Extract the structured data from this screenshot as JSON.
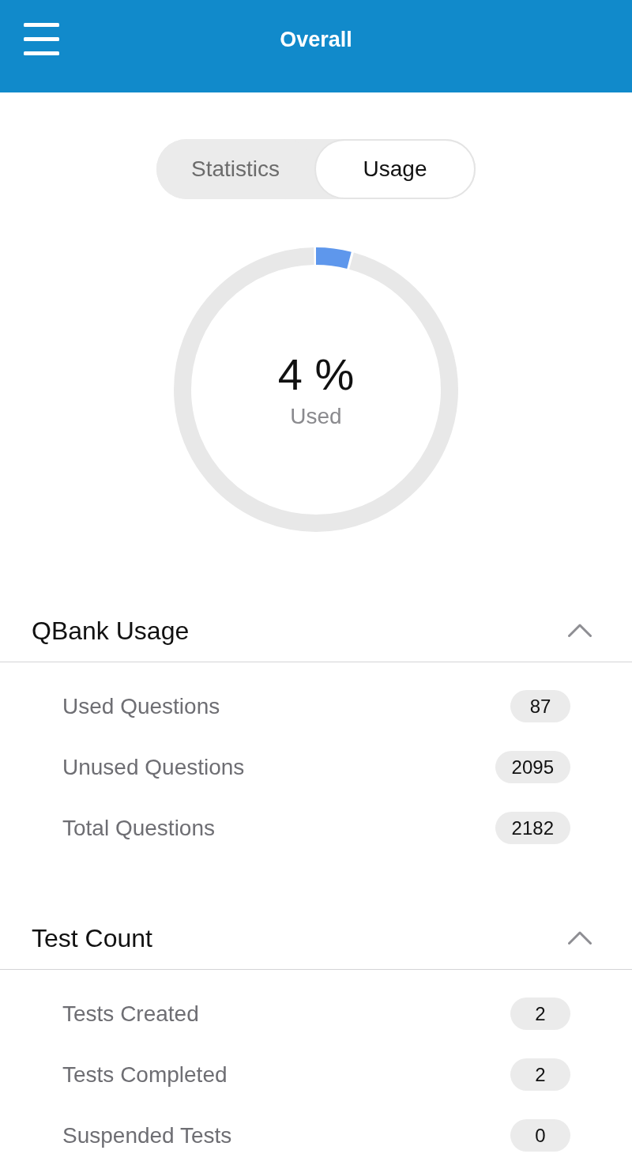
{
  "header": {
    "title": "Overall"
  },
  "tabs": [
    {
      "label": "Statistics",
      "selected": false
    },
    {
      "label": "Usage",
      "selected": true
    }
  ],
  "usage_ring": {
    "level": 0.04,
    "value": "4 %",
    "label": "Used"
  },
  "sections": [
    {
      "title": "QBank Usage",
      "expanded": true,
      "rows": [
        {
          "label": "Used Questions",
          "value": "87"
        },
        {
          "label": "Unused Questions",
          "value": "2095"
        },
        {
          "label": "Total Questions",
          "value": "2182"
        }
      ]
    },
    {
      "title": "Test Count",
      "expanded": true,
      "rows": [
        {
          "label": "Tests Created",
          "value": "2"
        },
        {
          "label": "Tests Completed",
          "value": "2"
        },
        {
          "label": "Suspended Tests",
          "value": "0"
        }
      ]
    }
  ]
}
